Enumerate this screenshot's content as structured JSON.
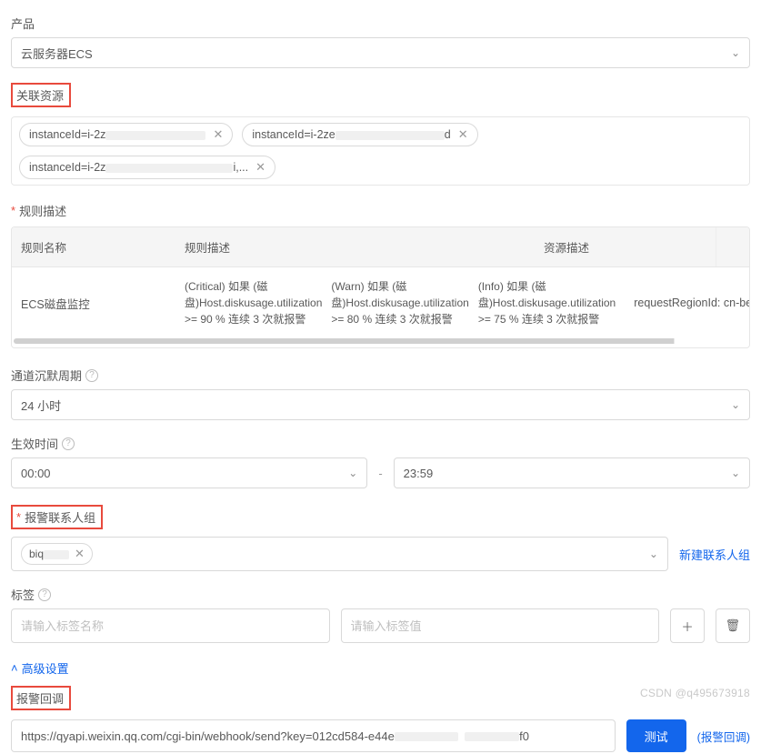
{
  "product": {
    "label": "产品",
    "value": "云服务器ECS"
  },
  "related_resources": {
    "label": "关联资源",
    "items": [
      {
        "prefix": "instanceId=i-2z"
      },
      {
        "prefix": "instanceId=i-2ze"
      },
      {
        "prefix": "instanceId=i-2z"
      }
    ]
  },
  "rule": {
    "label": "规则描述",
    "columns": {
      "name": "规则名称",
      "desc": "规则描述",
      "resource": "资源描述"
    },
    "row": {
      "name": "ECS磁盘监控",
      "desc_critical": "(Critical) 如果 (磁盘)Host.diskusage.utilization >= 90 % 连续 3 次就报警",
      "desc_warn": "(Warn) 如果 (磁盘)Host.diskusage.utilization >= 80 % 连续 3 次就报警",
      "desc_info": "(Info) 如果 (磁盘)Host.diskusage.utilization >= 75 % 连续 3 次就报警",
      "resource": "requestRegionId: cn-beijing"
    }
  },
  "mute": {
    "label": "通道沉默周期",
    "value": "24 小时"
  },
  "effective_time": {
    "label": "生效时间",
    "start": "00:00",
    "end": "23:59"
  },
  "contact_group": {
    "label": "报警联系人组",
    "chip": "biq",
    "new_link": "新建联系人组"
  },
  "tags": {
    "label": "标签",
    "name_placeholder": "请输入标签名称",
    "value_placeholder": "请输入标签值"
  },
  "advanced": {
    "toggle": "高级设置"
  },
  "callback": {
    "label": "报警回调",
    "url_start": "https://qyapi.weixin.qq.com/cgi-bin/webhook/send?key=012cd584-e44e",
    "url_end": "f0",
    "test_btn": "测试",
    "side_link": "(报警回调)"
  },
  "watermark": "CSDN @q495673918"
}
